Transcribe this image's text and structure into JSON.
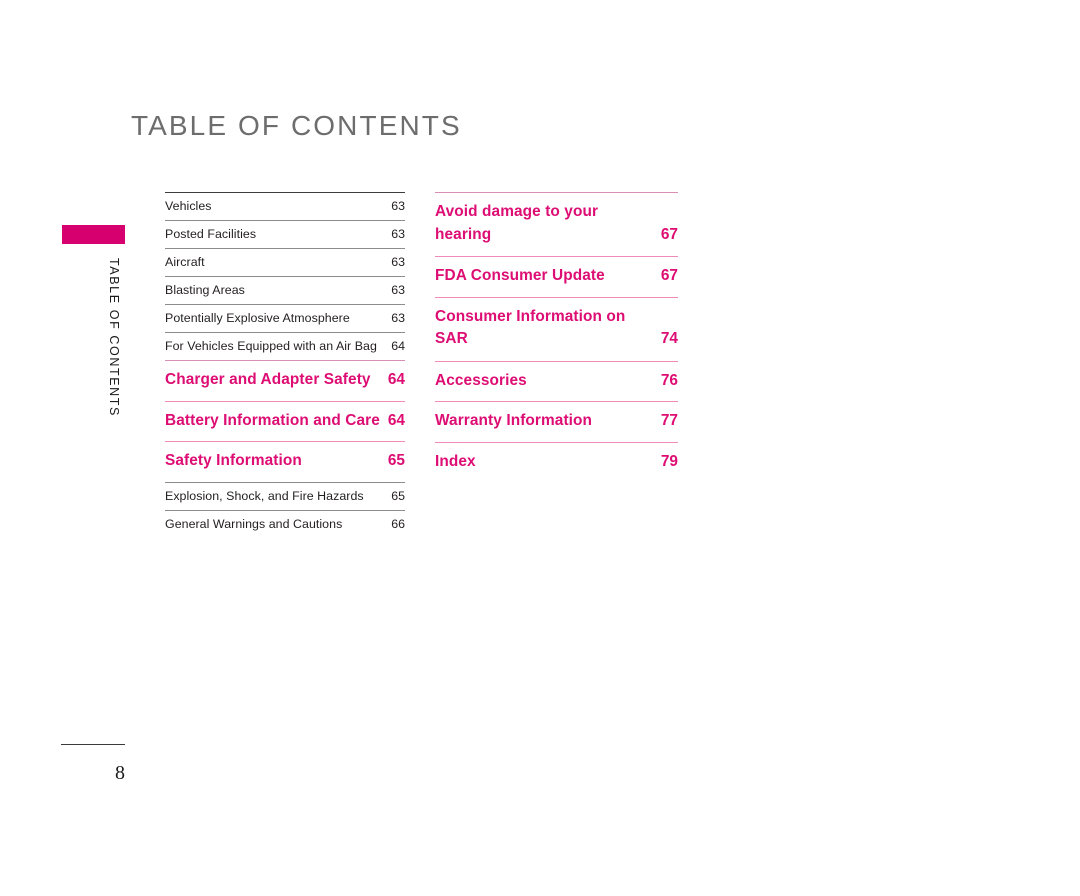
{
  "document": {
    "title": "TABLE OF CONTENTS",
    "side_tab_label": "TABLE OF CONTENTS",
    "folio": "8",
    "colors": {
      "accent_pink": "#dd0d73",
      "tab_pink": "#d6006f",
      "rule_pink": "#ee8ab8",
      "title_gray": "#6d6d6d",
      "body_black": "#231f20"
    }
  },
  "toc": {
    "left_column": [
      {
        "label": "Vehicles",
        "page": "63",
        "style": "sub"
      },
      {
        "label": "Posted Facilities",
        "page": "63",
        "style": "sub"
      },
      {
        "label": "Aircraft",
        "page": "63",
        "style": "sub"
      },
      {
        "label": "Blasting Areas",
        "page": "63",
        "style": "sub"
      },
      {
        "label": "Potentially Explosive Atmosphere",
        "page": "63",
        "style": "sub"
      },
      {
        "label": "For Vehicles Equipped with an Air Bag",
        "page": "64",
        "style": "sub"
      },
      {
        "label": "Charger and Adapter Safety",
        "page": "64",
        "style": "main"
      },
      {
        "label": "Battery Information and Care",
        "page": "64",
        "style": "main"
      },
      {
        "label": "Safety Information",
        "page": "65",
        "style": "main"
      },
      {
        "label": "Explosion, Shock, and Fire Hazards",
        "page": "65",
        "style": "sub"
      },
      {
        "label": "General Warnings and Cautions",
        "page": "66",
        "style": "sub"
      }
    ],
    "right_column": [
      {
        "label": "Avoid damage to your hearing",
        "page": "67",
        "style": "main"
      },
      {
        "label": "FDA Consumer Update",
        "page": "67",
        "style": "main"
      },
      {
        "label": "Consumer Information on SAR",
        "page": "74",
        "style": "main"
      },
      {
        "label": "Accessories",
        "page": "76",
        "style": "main"
      },
      {
        "label": "Warranty Information",
        "page": "77",
        "style": "main"
      },
      {
        "label": "Index",
        "page": "79",
        "style": "main"
      }
    ]
  }
}
